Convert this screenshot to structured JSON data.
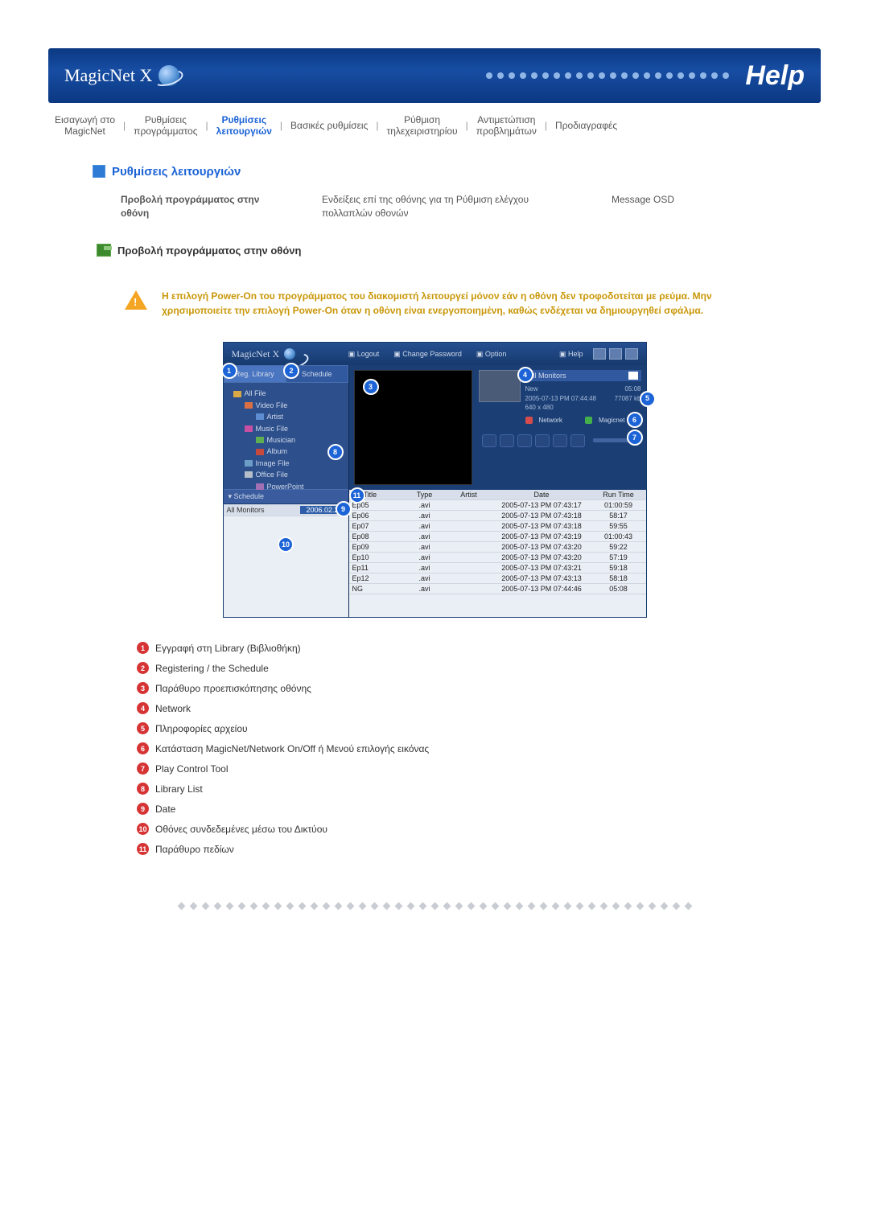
{
  "banner": {
    "brand": "MagicNet X",
    "help_label": "Help"
  },
  "topnav": {
    "items": [
      "Εισαγωγή στο\nMagicNet",
      "Ρυθμίσεις\nπρογράμματος",
      "Ρυθμίσεις\nλειτουργιών",
      "Βασικές ρυθμίσεις",
      "Ρύθμιση\nτηλεχειριστηρίου",
      "Αντιμετώπιση\nπροβλημάτων",
      "Προδιαγραφές"
    ],
    "active_index": 2
  },
  "section": {
    "title": "Ρυθμίσεις λειτουργιών"
  },
  "subnav": {
    "items": [
      "Προβολή προγράμματος στην οθόνη",
      "Ενδείξεις επί της οθόνης για τη Ρύθμιση ελέγχου πολλαπλών οθονών",
      "Message OSD"
    ]
  },
  "subsection": {
    "title": "Προβολή προγράμματος στην οθόνη"
  },
  "warning": {
    "text": "Η επιλογή Power-On του προγράμματος του διακομιστή λειτουργεί μόνον εάν η οθόνη δεν τροφοδοτείται με ρεύμα. Μην χρησιμοποιείτε την επιλογή Power-On όταν η οθόνη είναι ενεργοποιημένη, καθώς ενδέχεται να δημιουργηθεί σφάλμα."
  },
  "screenshot": {
    "brand": "MagicNet X",
    "top_buttons": [
      "Logout",
      "Change Password",
      "Option"
    ],
    "help_link": "Help",
    "left_tabs": [
      "Reg. Library",
      "Schedule"
    ],
    "tree": {
      "root": "All File",
      "items": [
        "Video File",
        "Artist",
        "Music File",
        "Musician",
        "Album",
        "Image File",
        "Office File",
        "PowerPoint"
      ]
    },
    "schedule_header": "Schedule",
    "schedule_row_label": "All Monitors",
    "schedule_date": "2006.02.2",
    "monitor_header": "All Monitors",
    "info": {
      "line1": "New",
      "line2": "2005-07-13 PM 07:44:48",
      "line3": "640 x 480",
      "file_time": "05:08",
      "file_size": "77087 kb"
    },
    "status": {
      "network_label": "Network",
      "magicnet_label": "Magicnet"
    },
    "grid": {
      "headers": [
        "Title",
        "Type",
        "Artist",
        "Date",
        "Run Time"
      ],
      "rows": [
        {
          "title": "Ep05",
          "type": ".avi",
          "artist": "",
          "date": "2005-07-13 PM 07:43:17",
          "run": "01:00:59"
        },
        {
          "title": "Ep06",
          "type": ".avi",
          "artist": "",
          "date": "2005-07-13 PM 07:43:18",
          "run": "58:17"
        },
        {
          "title": "Ep07",
          "type": ".avi",
          "artist": "",
          "date": "2005-07-13 PM 07:43:18",
          "run": "59:55"
        },
        {
          "title": "Ep08",
          "type": ".avi",
          "artist": "",
          "date": "2005-07-13 PM 07:43:19",
          "run": "01:00:43"
        },
        {
          "title": "Ep09",
          "type": ".avi",
          "artist": "",
          "date": "2005-07-13 PM 07:43:20",
          "run": "59:22"
        },
        {
          "title": "Ep10",
          "type": ".avi",
          "artist": "",
          "date": "2005-07-13 PM 07:43:20",
          "run": "57:19"
        },
        {
          "title": "Ep11",
          "type": ".avi",
          "artist": "",
          "date": "2005-07-13 PM 07:43:21",
          "run": "59:18"
        },
        {
          "title": "Ep12",
          "type": ".avi",
          "artist": "",
          "date": "2005-07-13 PM 07:43:13",
          "run": "58:18"
        },
        {
          "title": "NG",
          "type": ".avi",
          "artist": "",
          "date": "2005-07-13 PM 07:44:46",
          "run": "05:08"
        }
      ]
    }
  },
  "legend": {
    "items": [
      "Εγγραφή στη Library (Βιβλιοθήκη)",
      "Registering / the Schedule",
      "Παράθυρο προεπισκόπησης οθόνης",
      "Network",
      "Πληροφορίες αρχείου",
      "Κατάσταση MagicNet/Network On/Off ή Μενού επιλογής εικόνας",
      "Play Control Tool",
      "Library List",
      "Date",
      "Οθόνες συνδεδεμένες μέσω του Δικτύου",
      "Παράθυρο πεδίων"
    ]
  }
}
